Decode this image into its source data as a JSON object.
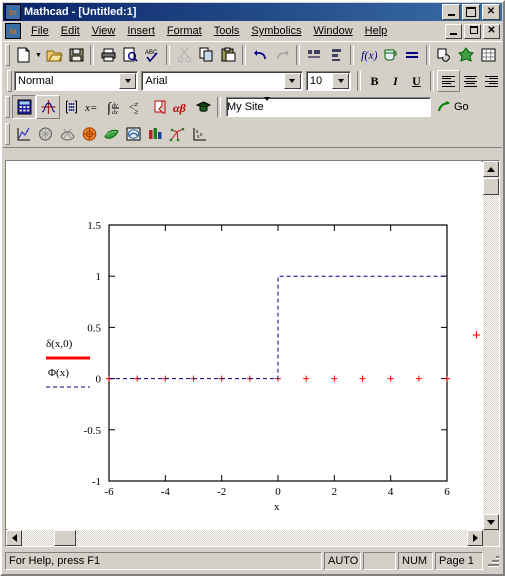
{
  "window": {
    "title": "Mathcad - [Untitled:1]",
    "app_icon": "mathcad-icon",
    "buttons": {
      "minimize": "minimize",
      "maximize": "maximize",
      "close": "close"
    },
    "doc_buttons": {
      "minimize": "minimize",
      "restore": "restore",
      "close": "close"
    }
  },
  "menu": {
    "items": [
      {
        "label": "File"
      },
      {
        "label": "Edit"
      },
      {
        "label": "View"
      },
      {
        "label": "Insert"
      },
      {
        "label": "Format"
      },
      {
        "label": "Tools"
      },
      {
        "label": "Symbolics"
      },
      {
        "label": "Window"
      },
      {
        "label": "Help"
      }
    ]
  },
  "standard_toolbar": {
    "items": [
      {
        "name": "new-document-button",
        "icon": "new-page-icon"
      },
      {
        "name": "new-document-dropdown",
        "icon": "chevron-down-icon"
      },
      {
        "name": "open-button",
        "icon": "open-folder-icon"
      },
      {
        "name": "save-button",
        "icon": "floppy-disk-icon"
      },
      {
        "name": "print-button",
        "icon": "printer-icon"
      },
      {
        "name": "print-preview-button",
        "icon": "print-preview-icon"
      },
      {
        "name": "check-spelling-button",
        "icon": "abc-check-icon"
      },
      {
        "name": "cut-button",
        "icon": "scissors-icon"
      },
      {
        "name": "copy-button",
        "icon": "copy-icon"
      },
      {
        "name": "paste-button",
        "icon": "clipboard-icon"
      },
      {
        "name": "undo-button",
        "icon": "undo-arrow-icon"
      },
      {
        "name": "redo-button",
        "icon": "redo-arrow-icon"
      },
      {
        "name": "align-across-button",
        "icon": "align-across-icon"
      },
      {
        "name": "align-down-button",
        "icon": "align-down-icon"
      },
      {
        "name": "insert-function-button",
        "icon": "fx-icon"
      },
      {
        "name": "insert-unit-button",
        "icon": "measuring-cup-icon"
      },
      {
        "name": "calculate-button",
        "icon": "equals-icon"
      },
      {
        "name": "insert-hyperlink-button",
        "icon": "hyperlink-icon"
      },
      {
        "name": "insert-component-button",
        "icon": "component-icon"
      },
      {
        "name": "insert-spreadsheet-button",
        "icon": "grid-icon"
      }
    ]
  },
  "format_toolbar": {
    "style": {
      "value": "Normal"
    },
    "font": {
      "value": "Arial"
    },
    "size": {
      "value": "10"
    },
    "bold": "B",
    "italic": "I",
    "underline": "U",
    "align_left": "align-left",
    "align_center": "align-center",
    "align_right": "align-right"
  },
  "math_toolbar": {
    "items": [
      {
        "name": "calculator-toolbar-button",
        "icon": "calculator-icon"
      },
      {
        "name": "graph-toolbar-button",
        "icon": "graph-axes-icon"
      },
      {
        "name": "matrix-toolbar-button",
        "icon": "matrix-icon"
      },
      {
        "name": "evaluation-toolbar-button",
        "icon": "x-equals-icon"
      },
      {
        "name": "calculus-toolbar-button",
        "icon": "integral-derivative-icon"
      },
      {
        "name": "boolean-toolbar-button",
        "icon": "less-than-icon"
      },
      {
        "name": "programming-toolbar-button",
        "icon": "programming-icon"
      },
      {
        "name": "greek-toolbar-button",
        "icon": "alpha-beta-icon"
      },
      {
        "name": "symbolic-toolbar-button",
        "icon": "mortarboard-icon"
      }
    ],
    "address": {
      "value": "My Site",
      "placeholder": ""
    },
    "go_label": "Go",
    "go_icon": "go-arrow-icon"
  },
  "graph_toolbar": {
    "items": [
      {
        "name": "xy-plot-button",
        "icon": "xy-plot-icon"
      },
      {
        "name": "polar-plot-button",
        "icon": "polar-plot-icon"
      },
      {
        "name": "surface-plot-button",
        "icon": "surface-plot-icon"
      },
      {
        "name": "contour-plot-button",
        "icon": "contour-plot-icon"
      },
      {
        "name": "3d-scatter-plot-button",
        "icon": "scatter-3d-icon"
      },
      {
        "name": "3d-bar-plot-button",
        "icon": "bar-3d-icon"
      },
      {
        "name": "vector-field-plot-button",
        "icon": "vector-field-icon"
      },
      {
        "name": "zoom-button",
        "icon": "graph-zoom-icon"
      },
      {
        "name": "trace-button",
        "icon": "graph-trace-icon"
      }
    ]
  },
  "document": {
    "cursor_marker": "+",
    "cursor_color": "#ff0000"
  },
  "status_bar": {
    "message": "For Help, press F1",
    "auto": "AUTO",
    "blank": "",
    "num": "NUM",
    "page": "Page 1"
  },
  "chart_data": {
    "type": "line",
    "title": "",
    "xlabel": "x",
    "ylabel": "",
    "xlim": [
      -6,
      6
    ],
    "ylim": [
      -1,
      1.5
    ],
    "xticks": [
      -6,
      -4,
      -2,
      0,
      2,
      4,
      6
    ],
    "xtick_labels": [
      "-6",
      "-4",
      "-2",
      "0",
      "2",
      "4",
      "6"
    ],
    "yticks": [
      -1,
      -0.5,
      0,
      0.5,
      1,
      1.5
    ],
    "ytick_labels": [
      "-1",
      "-0.5",
      "0",
      "0.5",
      "1",
      "1.5"
    ],
    "grid": false,
    "legend_position": "left",
    "series": [
      {
        "name": "δ(x,0)",
        "style": "markers",
        "marker": "+",
        "color": "#ff0000",
        "line_style": "solid",
        "line_width": 3,
        "x": [
          -6,
          -5,
          -4,
          -3,
          -2,
          -1,
          0,
          1,
          2,
          3,
          4,
          5,
          6
        ],
        "values": [
          0,
          0,
          0,
          0,
          0,
          0,
          0,
          0,
          0,
          0,
          0,
          0,
          0
        ]
      },
      {
        "name": "Φ(x)",
        "style": "step",
        "color": "#000080",
        "line_style": "dashed",
        "line_width": 1,
        "x": [
          -6,
          -5,
          -4,
          -3,
          -2,
          -1,
          0,
          0,
          1,
          2,
          3,
          4,
          5,
          6
        ],
        "values": [
          0,
          0,
          0,
          0,
          0,
          0,
          0,
          1,
          1,
          1,
          1,
          1,
          1,
          1
        ]
      }
    ]
  }
}
